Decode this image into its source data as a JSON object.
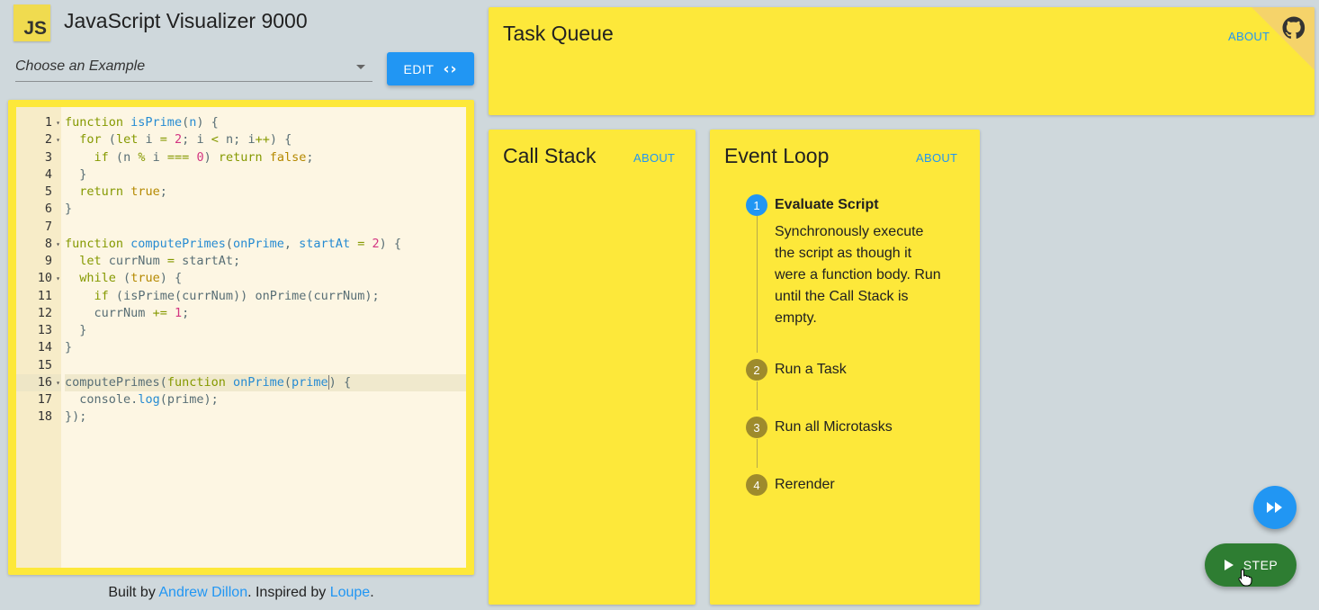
{
  "header": {
    "logo_text": "JS",
    "title": "JavaScript Visualizer 9000"
  },
  "example_select": {
    "placeholder": "Choose an Example"
  },
  "edit_button": {
    "label": "EDIT",
    "icon": "code-icon"
  },
  "editor": {
    "active_line": 16,
    "lines": [
      {
        "num": "1",
        "fold": true
      },
      {
        "num": "2",
        "fold": true
      },
      {
        "num": "3",
        "fold": false
      },
      {
        "num": "4",
        "fold": false
      },
      {
        "num": "5",
        "fold": false
      },
      {
        "num": "6",
        "fold": false
      },
      {
        "num": "7",
        "fold": false
      },
      {
        "num": "8",
        "fold": true
      },
      {
        "num": "9",
        "fold": false
      },
      {
        "num": "10",
        "fold": true
      },
      {
        "num": "11",
        "fold": false
      },
      {
        "num": "12",
        "fold": false
      },
      {
        "num": "13",
        "fold": false
      },
      {
        "num": "14",
        "fold": false
      },
      {
        "num": "15",
        "fold": false
      },
      {
        "num": "16",
        "fold": true
      },
      {
        "num": "17",
        "fold": false
      },
      {
        "num": "18",
        "fold": false
      }
    ],
    "code": [
      "function isPrime(n) {",
      "  for (let i = 2; i < n; i++) {",
      "    if (n % i === 0) return false;",
      "  }",
      "  return true;",
      "}",
      "",
      "function computePrimes(onPrime, startAt = 2) {",
      "  let currNum = startAt;",
      "  while (true) {",
      "    if (isPrime(currNum)) onPrime(currNum);",
      "    currNum += 1;",
      "  }",
      "}",
      "",
      "computePrimes(function onPrime(prime) {",
      "  console.log(prime);",
      "});"
    ]
  },
  "footer": {
    "prefix": "Built by ",
    "author": "Andrew Dillon",
    "middle": ". Inspired by ",
    "inspiration": "Loupe",
    "suffix": "."
  },
  "task_queue": {
    "title": "Task Queue",
    "about": "ABOUT",
    "corner_icon": "github-octocat-icon"
  },
  "call_stack": {
    "title": "Call Stack",
    "about": "ABOUT"
  },
  "event_loop": {
    "title": "Event Loop",
    "about": "ABOUT",
    "steps": [
      {
        "n": "1",
        "label": "Evaluate Script",
        "active": true
      },
      {
        "n": "2",
        "label": "Run a Task",
        "active": false
      },
      {
        "n": "3",
        "label": "Run all Microtasks",
        "active": false
      },
      {
        "n": "4",
        "label": "Rerender",
        "active": false
      }
    ],
    "active_description": "Synchronously execute the script as though it were a function body. Run until the Call Stack is empty."
  },
  "controls": {
    "fast_forward_icon": "fast-forward-icon",
    "step_label": "STEP",
    "step_icon": "play-icon"
  },
  "colors": {
    "panel": "#fde83a",
    "accent": "#2196f3",
    "step_button": "#2e7d32",
    "background": "#cfd8dc"
  }
}
